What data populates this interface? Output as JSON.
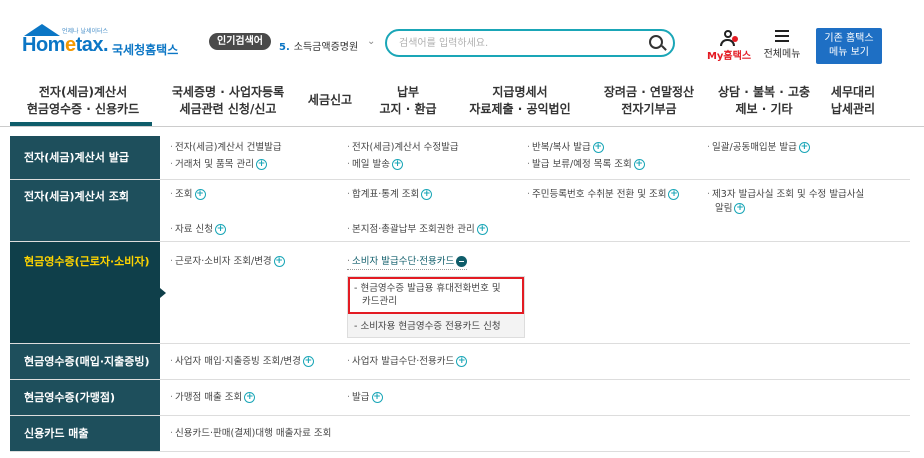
{
  "header": {
    "logo_small": "언제나 날세이터스",
    "logo_brand_a": "Hom",
    "logo_brand_e": "e",
    "logo_brand_b": "tax.",
    "logo_kr": "국세청홈택스",
    "popular_label": "인기검색어",
    "popular_num": "5.",
    "popular_text": "소득금액증명원",
    "search_placeholder": "검색어를 입력하세요.",
    "my_hometax": "My홈택스",
    "all_menu": "전체메뉴",
    "old_line1": "기존 홈택스",
    "old_line2": "메뉴 보기"
  },
  "gnb": [
    {
      "l1": "전자(세금)계산서",
      "l2": "현금영수증 · 신용카드"
    },
    {
      "l1": "국세증명 · 사업자등록",
      "l2": "세금관련 신청/신고"
    },
    {
      "l1": "세금신고",
      "l2": ""
    },
    {
      "l1": "납부",
      "l2": "고지 · 환급"
    },
    {
      "l1": "지급명세서",
      "l2": "자료제출 · 공익법인"
    },
    {
      "l1": "장려금 · 연말정산",
      "l2": "전자기부금"
    },
    {
      "l1": "상담 · 불복 · 고충",
      "l2": "제보 · 기타"
    },
    {
      "l1": "세무대리",
      "l2": "납세관리"
    }
  ],
  "rows": {
    "r1_head": "전자(세금)계산서 발급",
    "r1": [
      "전자(세금)계산서 건별발급",
      "전자(세금)계산서 수정발급",
      "반복/복사 발급",
      "일괄/공동매입분 발급",
      "거래처 및 품목 관리",
      "메일 발송",
      "발급 보류/예정 목록 조회"
    ],
    "r2_head": "전자(세금)계산서 조회",
    "r2": [
      "조회",
      "합계표·통계 조회",
      "주민등록번호 수취분 전환 및 조회",
      "제3자 발급사실 조회 및 수정 발급사실",
      "알림",
      "자료 신청",
      "본지점·총괄납부 조회권한 관리"
    ],
    "r3_head": "현금영수증(근로자·소비자)",
    "r3": [
      "근로자·소비자 조회/변경",
      "소비자 발급수단·전용카드"
    ],
    "r3_sub": [
      "- 현금영수증 발급용 휴대전화번호 및",
      "카드관리",
      "- 소비자용 현금영수증 전용카드 신청"
    ],
    "r4_head": "현금영수증(매입·지출증빙)",
    "r4": [
      "사업자 매입·지출증빙 조회/변경",
      "사업자 발급수단·전용카드"
    ],
    "r5_head": "현금영수증(가맹점)",
    "r5": [
      "가맹점 매출 조회",
      "발급"
    ],
    "r6_head": "신용카드 매출",
    "r6": [
      "신용카드·판매(결제)대행 매출자료 조회"
    ]
  }
}
